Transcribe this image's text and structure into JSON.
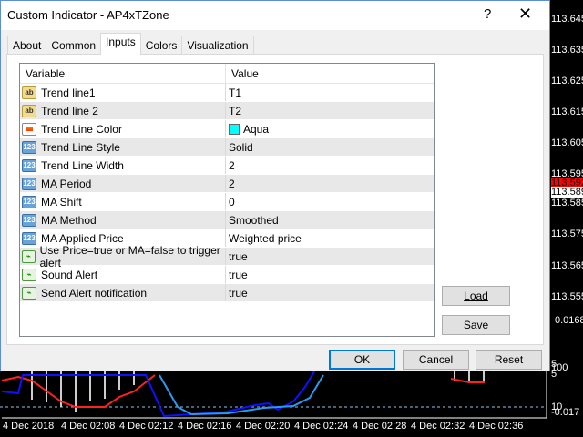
{
  "dialog": {
    "title": "Custom Indicator - AP4xTZone",
    "help_label": "?",
    "close_label": "✕"
  },
  "tabs": [
    {
      "label": "About"
    },
    {
      "label": "Common"
    },
    {
      "label": "Inputs",
      "active": true
    },
    {
      "label": "Colors"
    },
    {
      "label": "Visualization"
    }
  ],
  "table": {
    "headers": [
      "Variable",
      "Value"
    ],
    "rows": [
      {
        "icon": "ab",
        "variable": "Trend line1",
        "value": "T1"
      },
      {
        "icon": "ab",
        "variable": "Trend line 2",
        "value": "T2"
      },
      {
        "icon": "color",
        "variable": "Trend Line Color",
        "value": "Aqua",
        "swatch": "#00ffff"
      },
      {
        "icon": "123",
        "variable": "Trend Line Style",
        "value": "Solid"
      },
      {
        "icon": "123",
        "variable": "Trend Line Width",
        "value": "2"
      },
      {
        "icon": "123",
        "variable": "MA Period",
        "value": "2"
      },
      {
        "icon": "123",
        "variable": "MA Shift",
        "value": "0"
      },
      {
        "icon": "123",
        "variable": "MA Method",
        "value": "Smoothed"
      },
      {
        "icon": "123",
        "variable": "MA Applied Price",
        "value": "Weighted price"
      },
      {
        "icon": "bool",
        "variable": "Use Price=true or MA=false to trigger alert",
        "value": "true"
      },
      {
        "icon": "bool",
        "variable": "Sound Alert",
        "value": "true"
      },
      {
        "icon": "bool",
        "variable": "Send Alert notification",
        "value": "true"
      }
    ]
  },
  "buttons": {
    "load": "Load",
    "save": "Save",
    "ok": "OK",
    "cancel": "Cancel",
    "reset": "Reset"
  },
  "price_axis": [
    "113.645",
    "113.635",
    "113.625",
    "113.615",
    "113.605",
    "113.595",
    "113.592",
    "113.589",
    "113.585",
    "113.575",
    "113.565",
    "113.555",
    "0.0168"
  ],
  "indicator_axis": [
    "5",
    "100",
    "5",
    "10",
    "-0.017"
  ],
  "time_axis": [
    "4 Dec 2018",
    "4 Dec 02:08",
    "4 Dec 02:12",
    "4 Dec 02:16",
    "4 Dec 02:20",
    "4 Dec 02:24",
    "4 Dec 02:28",
    "4 Dec 02:32",
    "4 Dec 02:36"
  ],
  "colors": {
    "bid_label": "#ff0000",
    "ask_label": "#ffffff",
    "accent": "#0078d7"
  }
}
